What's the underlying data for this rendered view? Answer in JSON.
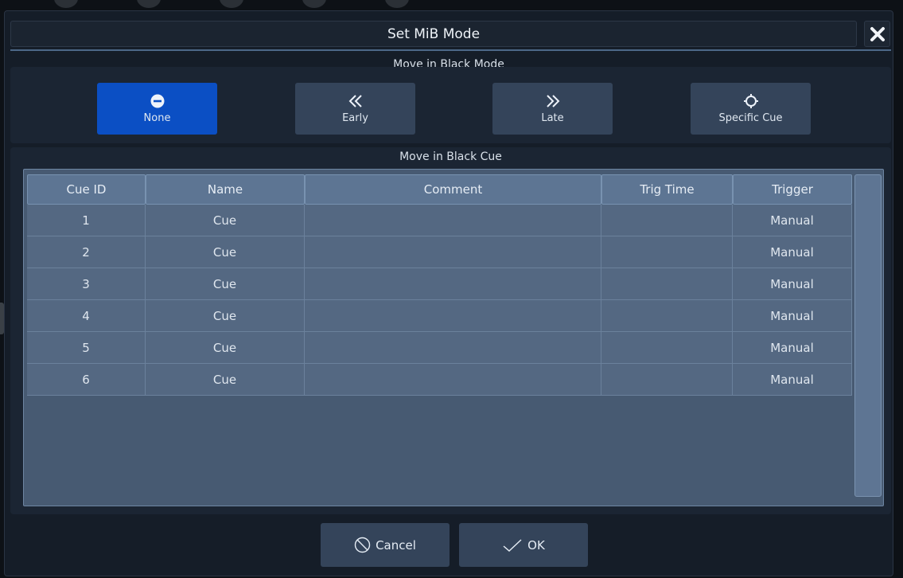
{
  "dialog": {
    "title": "Set MiB Mode",
    "close_icon": "close-icon"
  },
  "mode_section": {
    "label": "Move in Black Mode",
    "selected": "None",
    "buttons": [
      {
        "label": "None",
        "icon": "minus-circle-icon",
        "active": true
      },
      {
        "label": "Early",
        "icon": "double-chevron-left-icon",
        "active": false
      },
      {
        "label": "Late",
        "icon": "double-chevron-right-icon",
        "active": false
      },
      {
        "label": "Specific Cue",
        "icon": "crosshair-icon",
        "active": false
      }
    ]
  },
  "cue_section": {
    "label": "Move in Black Cue",
    "columns": [
      "Cue ID",
      "Name",
      "Comment",
      "Trig Time",
      "Trigger"
    ],
    "rows": [
      {
        "cue_id": "1",
        "name": "Cue",
        "comment": "",
        "trig_time": "",
        "trigger": "Manual"
      },
      {
        "cue_id": "2",
        "name": "Cue",
        "comment": "",
        "trig_time": "",
        "trigger": "Manual"
      },
      {
        "cue_id": "3",
        "name": "Cue",
        "comment": "",
        "trig_time": "",
        "trigger": "Manual"
      },
      {
        "cue_id": "4",
        "name": "Cue",
        "comment": "",
        "trig_time": "",
        "trigger": "Manual"
      },
      {
        "cue_id": "5",
        "name": "Cue",
        "comment": "",
        "trig_time": "",
        "trigger": "Manual"
      },
      {
        "cue_id": "6",
        "name": "Cue",
        "comment": "",
        "trig_time": "",
        "trigger": "Manual"
      }
    ]
  },
  "footer": {
    "cancel_label": "Cancel",
    "cancel_icon": "cancel-circle-icon",
    "ok_label": "OK",
    "ok_icon": "checkmark-icon"
  },
  "colors": {
    "active_button": "#0b4fc4",
    "button": "#34445a",
    "panel": "#1b2533",
    "table_cell": "#546882",
    "table_header": "#5d7593"
  }
}
